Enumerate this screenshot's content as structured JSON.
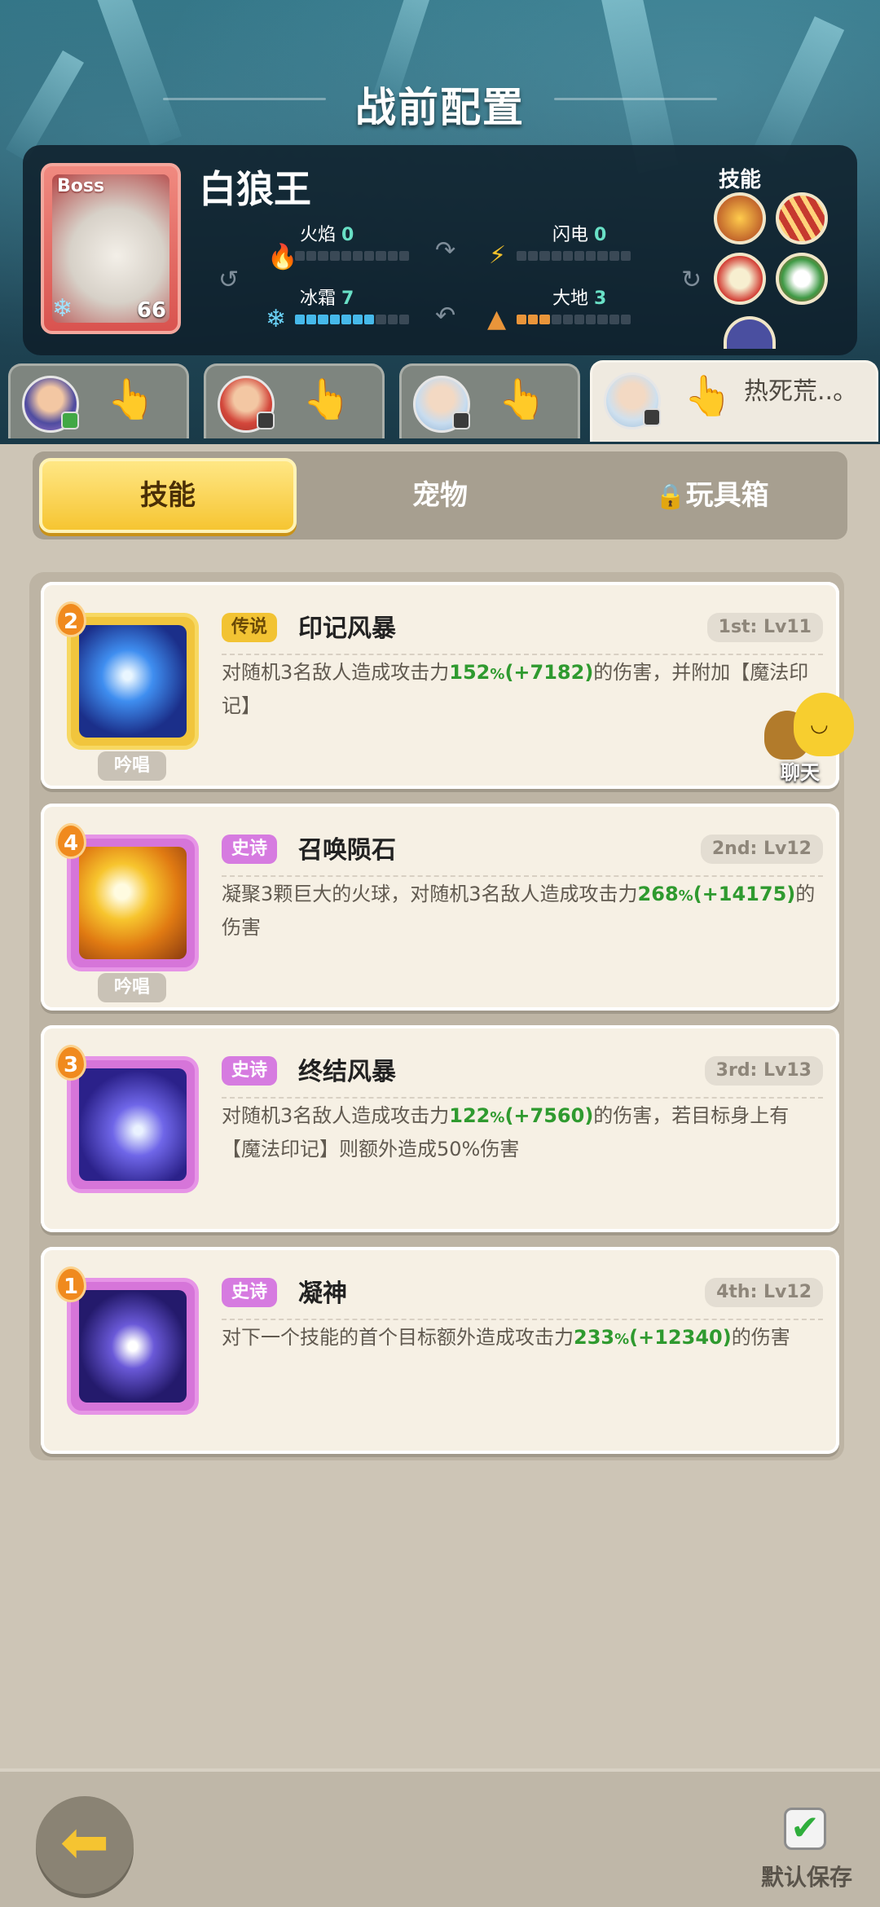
{
  "screen": {
    "title": "战前配置"
  },
  "boss": {
    "tag": "Boss",
    "name": "白狼王",
    "level": "66",
    "skills_label": "技能",
    "stats": {
      "fire": {
        "label": "火焰",
        "value": "0",
        "level": 0
      },
      "lightning": {
        "label": "闪电",
        "value": "0",
        "level": 0
      },
      "frost": {
        "label": "冰霜",
        "value": "7",
        "level": 7
      },
      "earth": {
        "label": "大地",
        "value": "3",
        "level": 3
      }
    }
  },
  "heroes": [
    {
      "name": "",
      "active": false
    },
    {
      "name": "",
      "active": false
    },
    {
      "name": "",
      "active": false
    },
    {
      "name": "热死荒..。",
      "active": true
    }
  ],
  "categories": [
    {
      "label": "技能",
      "active": true
    },
    {
      "label": "宠物",
      "active": false
    },
    {
      "label": "玩具箱",
      "active": false,
      "locked": true
    }
  ],
  "skills": [
    {
      "order": "2",
      "rarity": "传说",
      "name": "印记风暴",
      "slot": "1st: Lv11",
      "tag": "吟唱",
      "desc_a": "对随机3名敌人造成攻击力",
      "pct": "152",
      "pct_unit": "%",
      "bonus": "(+7182)",
      "desc_b": "的伤害，并附加【魔法印记】"
    },
    {
      "order": "4",
      "rarity": "史诗",
      "name": "召唤陨石",
      "slot": "2nd: Lv12",
      "tag": "吟唱",
      "desc_a": "凝聚3颗巨大的火球，对随机3名敌人造成攻击力",
      "pct": "268",
      "pct_unit": "%",
      "bonus": "(+14175)",
      "desc_b": "的伤害"
    },
    {
      "order": "3",
      "rarity": "史诗",
      "name": "终结风暴",
      "slot": "3rd: Lv13",
      "tag": "",
      "desc_a": "对随机3名敌人造成攻击力",
      "pct": "122",
      "pct_unit": "%",
      "bonus": "(+7560)",
      "desc_b": "的伤害，若目标身上有【魔法印记】则额外造成50%伤害"
    },
    {
      "order": "1",
      "rarity": "史诗",
      "name": "凝神",
      "slot": "4th: Lv12",
      "tag": "",
      "desc_a": "对下一个技能的首个目标额外造成攻击力",
      "pct": "233",
      "pct_unit": "%",
      "bonus": "(+12340)",
      "desc_b": "的伤害"
    }
  ],
  "chat": {
    "label": "聊天"
  },
  "footer": {
    "save_label": "默认保存"
  },
  "colors": {
    "accent_gold": "#f6c532",
    "legend": "#f2c333",
    "epic": "#d67be0",
    "bonus_green": "#2f9a2f"
  }
}
